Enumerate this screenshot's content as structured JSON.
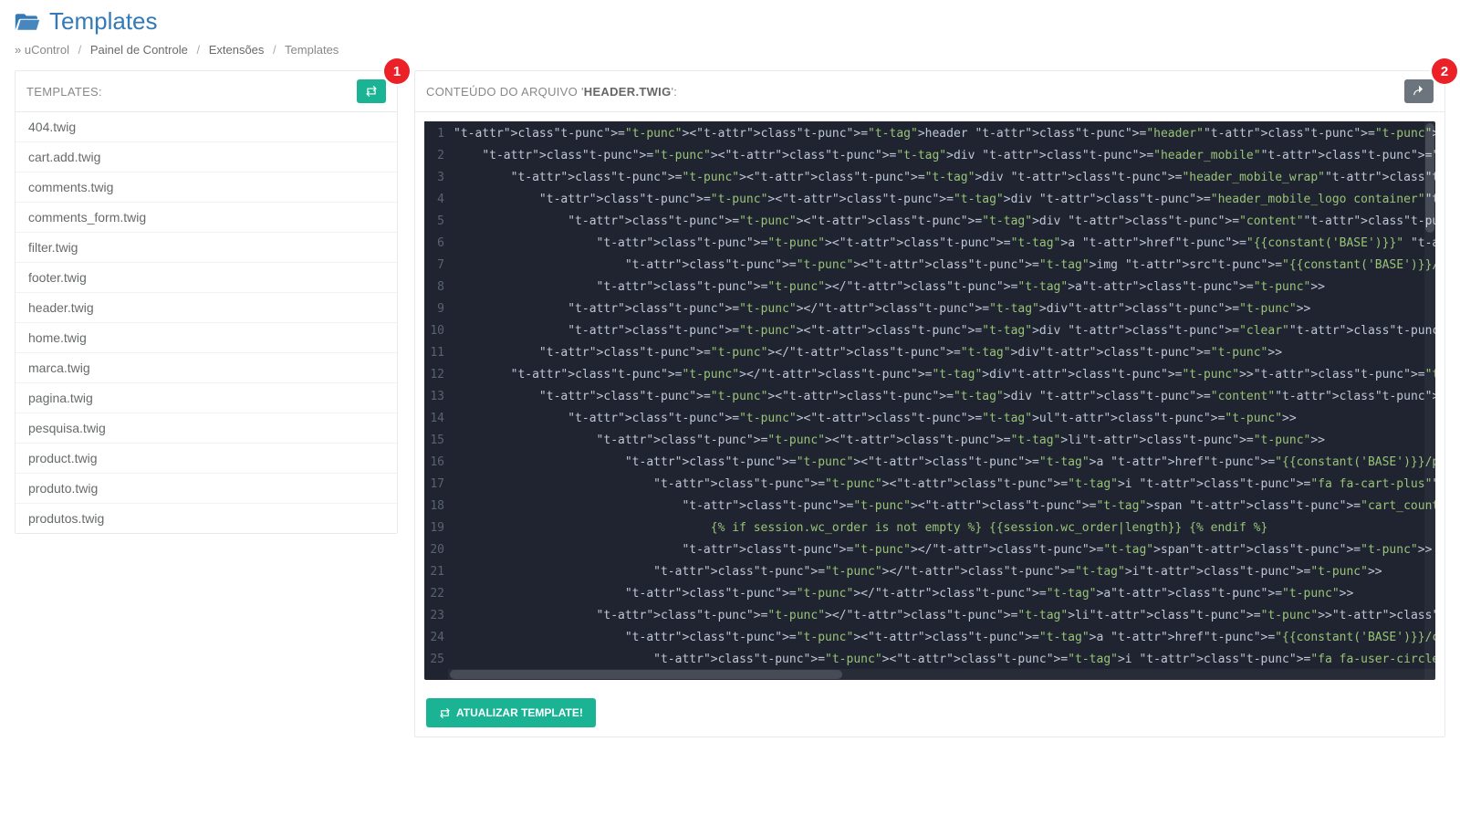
{
  "page": {
    "title": "Templates"
  },
  "breadcrumb": {
    "prefix": "» uControl",
    "items": [
      "Painel de Controle",
      "Extensões",
      "Templates"
    ]
  },
  "sidebar": {
    "title": "TEMPLATES:",
    "files": [
      "404.twig",
      "cart.add.twig",
      "comments.twig",
      "comments_form.twig",
      "filter.twig",
      "footer.twig",
      "header.twig",
      "home.twig",
      "marca.twig",
      "pagina.twig",
      "pesquisa.twig",
      "product.twig",
      "produto.twig",
      "produtos.twig"
    ]
  },
  "editor": {
    "title_prefix": "CONTEÚDO DO ARQUIVO '",
    "title_file": "HEADER.TWIG",
    "title_suffix": "':",
    "line_count": 25,
    "update_button": "ATUALIZAR TEMPLATE!",
    "code_lines": [
      "<header class=\"header\">",
      "    <div class=\"header_mobile\">",
      "        <div class=\"header_mobile_wrap\">",
      "            <div class=\"header_mobile_logo container\">",
      "                <div class=\"content\">",
      "                    <a href=\"{{constant('BASE')}}\" title=\"{{constant('SITE_NAME')}}\">",
      "                        <img src=\"{{constant('BASE')}}/uploads/{{constant('LOGO')}}\" alt=\"{{constant('SITE_NAME')}}\" title=\"{{constant('SITE_NAM",
      "                    </a>",
      "                </div>",
      "                <div class=\"clear\"></div>",
      "            </div>",
      "        </div><div class=\"header_mobile_nav container\">",
      "            <div class=\"content\">",
      "                <ul>",
      "                    <li>",
      "                        <a href=\"{{constant('BASE')}}/pedido/home#cart\" title=\"Meu Carrinho\">",
      "                            <i class=\"fa fa-cart-plus\">",
      "                                <span class=\"cart_count{% if session.wc_order is not empty %} active {% endif %}\">",
      "                                    {% if session.wc_order is not empty %} {{session.wc_order|length}} {% endif %}",
      "                                </span>",
      "                            </i>",
      "                        </a>",
      "                    </li><li>",
      "                        <a href=\"{{constant('BASE')}}/conta\" title=\"Minha Conta\">",
      "                            <i class=\"fa fa-user-circle-o\"></i>"
    ]
  },
  "callouts": {
    "one": "1",
    "two": "2"
  }
}
